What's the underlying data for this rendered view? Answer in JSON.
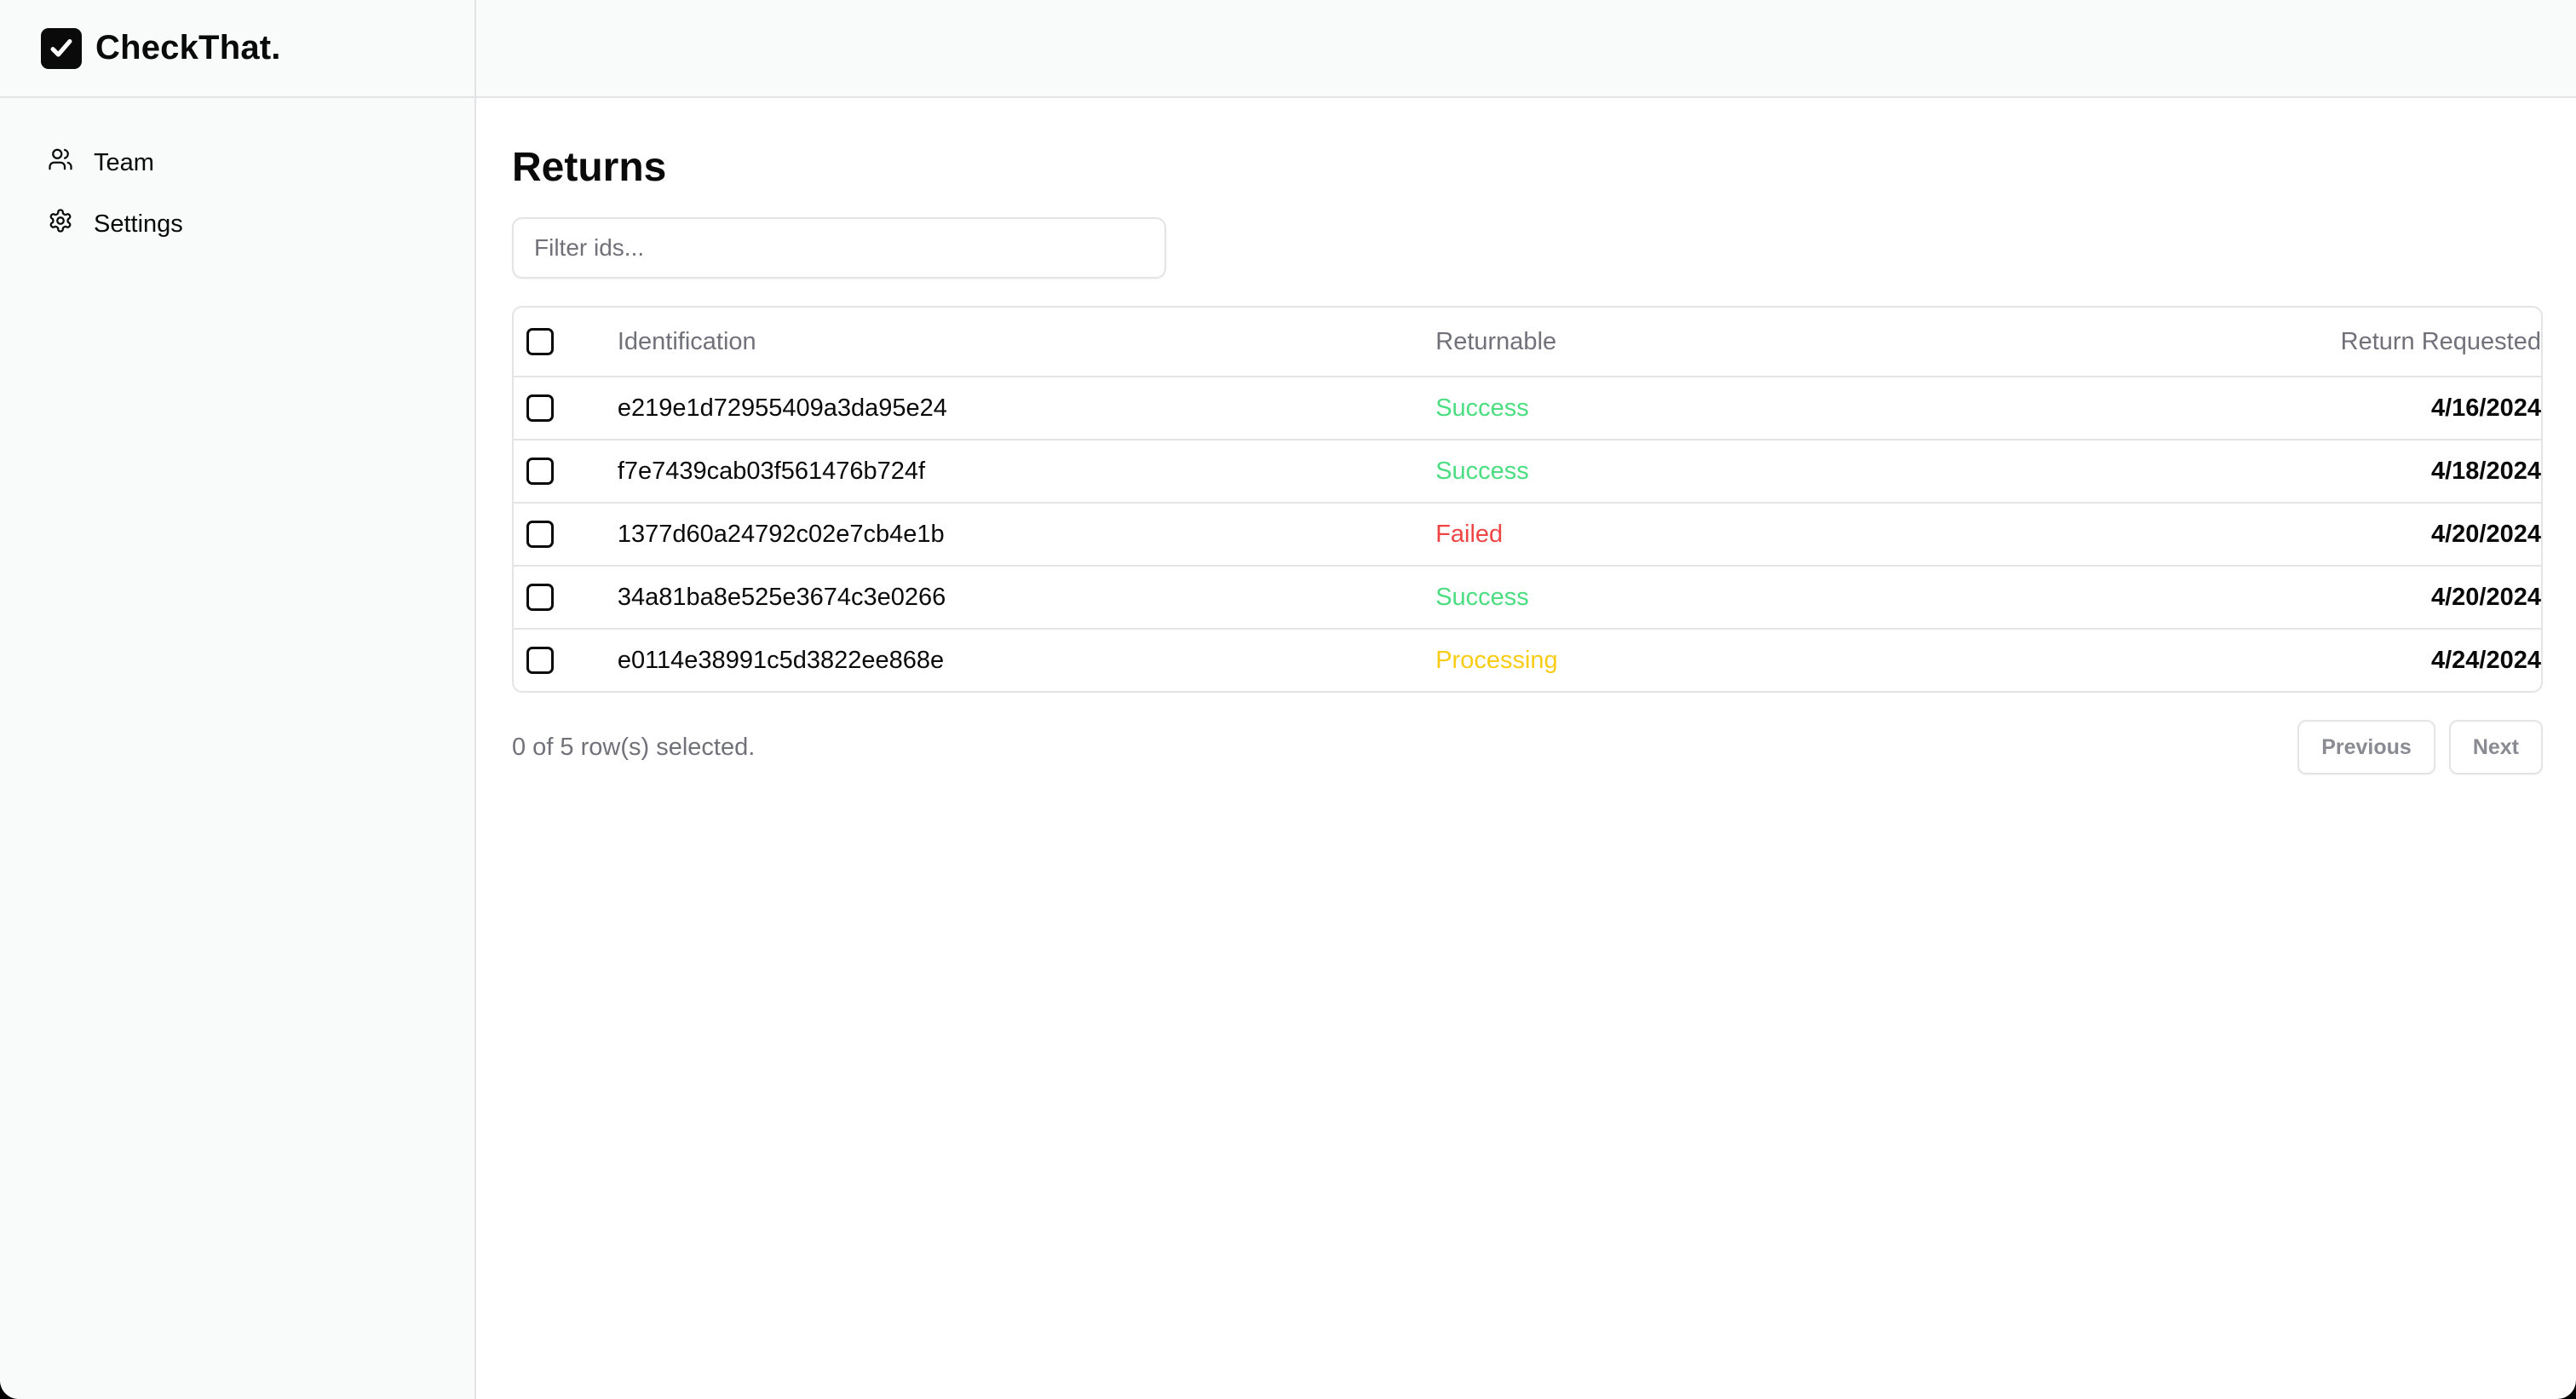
{
  "app": {
    "name": "CheckThat."
  },
  "sidebar": {
    "items": [
      {
        "label": "Team",
        "icon": "users-icon"
      },
      {
        "label": "Settings",
        "icon": "gear-icon"
      }
    ]
  },
  "page": {
    "title": "Returns",
    "filter": {
      "placeholder": "Filter ids...",
      "value": ""
    }
  },
  "table": {
    "columns": [
      "Identification",
      "Returnable",
      "Return Requested"
    ],
    "sort_icon": "chevrons-up-down-icon",
    "status_colors": {
      "Success": "#4ade80",
      "Failed": "#ef4444",
      "Processing": "#facc15"
    },
    "rows": [
      {
        "id": "e219e1d72955409a3da95e24",
        "status": "Success",
        "date": "4/16/2024"
      },
      {
        "id": "f7e7439cab03f561476b724f",
        "status": "Success",
        "date": "4/18/2024"
      },
      {
        "id": "1377d60a24792c02e7cb4e1b",
        "status": "Failed",
        "date": "4/20/2024"
      },
      {
        "id": "34a81ba8e525e3674c3e0266",
        "status": "Success",
        "date": "4/20/2024"
      },
      {
        "id": "e0114e38991c5d3822ee868e",
        "status": "Processing",
        "date": "4/24/2024"
      }
    ]
  },
  "footer": {
    "selection_text": "0 of 5 row(s) selected.",
    "previous_label": "Previous",
    "next_label": "Next"
  }
}
